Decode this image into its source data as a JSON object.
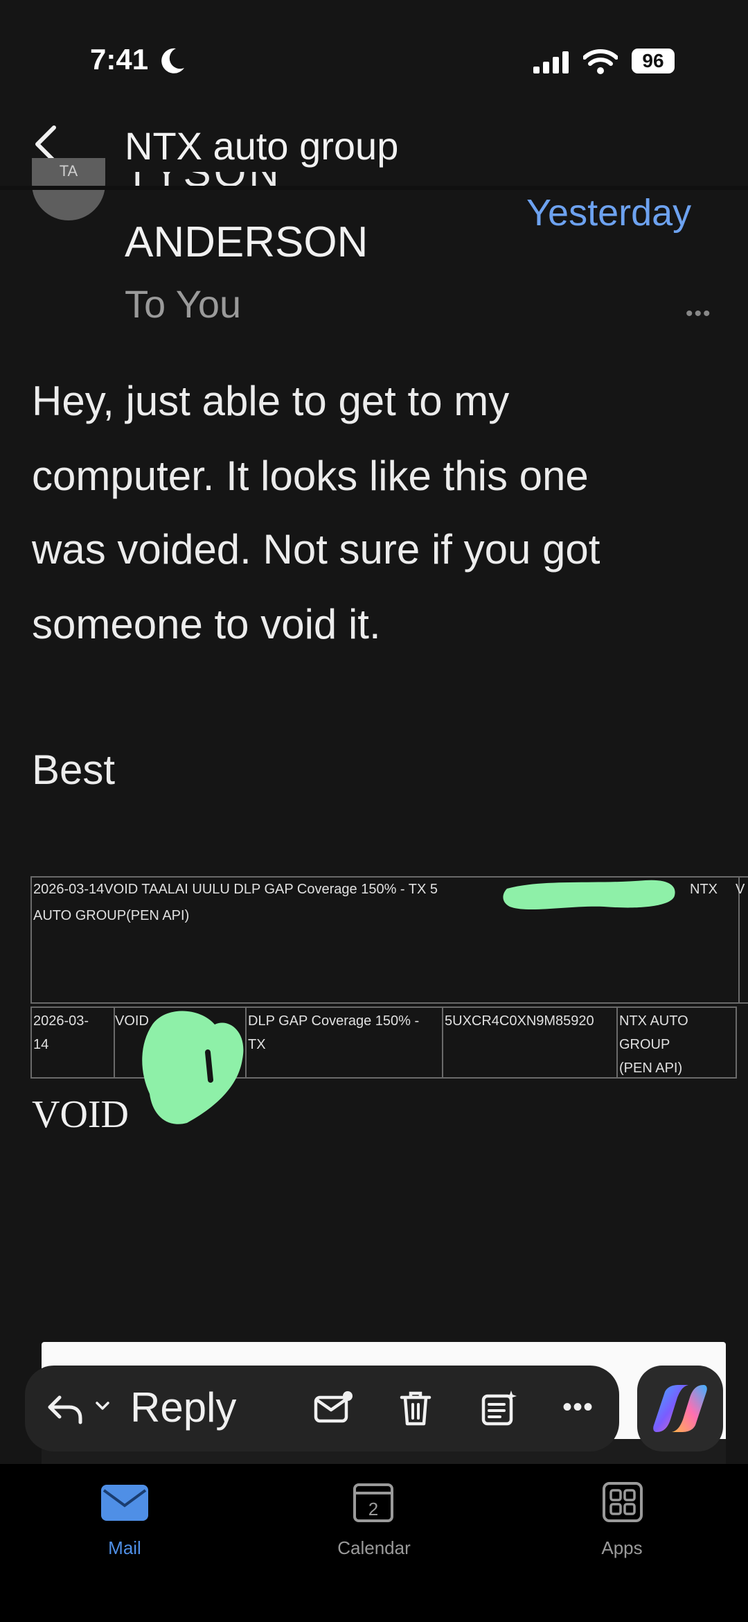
{
  "status_bar": {
    "time": "7:41",
    "battery": "96"
  },
  "header": {
    "title": "NTX auto group"
  },
  "message": {
    "sender_avatar_initials": "TA",
    "sender_name_partial": "TYSON",
    "sender_name": "ANDERSON",
    "date": "Yesterday",
    "recipient": "To You",
    "body_lines": [
      "Hey,  just able to get to my",
      "computer. It looks like this one",
      "was voided. Not sure if you got",
      "someone to void it."
    ],
    "signoff": "Best"
  },
  "table_one": {
    "line1": "2026-03-14VOID TAALAI UULU DLP GAP Coverage 150% - TX 5",
    "line2": "AUTO GROUP(PEN API)",
    "right_text": "NTX",
    "edge_text": "V"
  },
  "table_two": {
    "cells": [
      [
        "2026-03-",
        "14"
      ],
      [
        "VOID"
      ],
      [
        "DLP GAP Coverage 150% -",
        "TX"
      ],
      [
        "5UXCR4C0XN9M85920"
      ],
      [
        "NTX AUTO",
        "GROUP",
        "(PEN API)"
      ]
    ]
  },
  "void_label": "VOID",
  "action_bar": {
    "reply_label": "Reply"
  },
  "tabs": [
    {
      "label": "Mail",
      "active": true
    },
    {
      "label": "Calendar",
      "calendar_day": "2"
    },
    {
      "label": "Apps"
    }
  ],
  "colors": {
    "background": "#151515",
    "accent_blue": "#6da2f0",
    "redaction_green": "#8ef0a8"
  }
}
